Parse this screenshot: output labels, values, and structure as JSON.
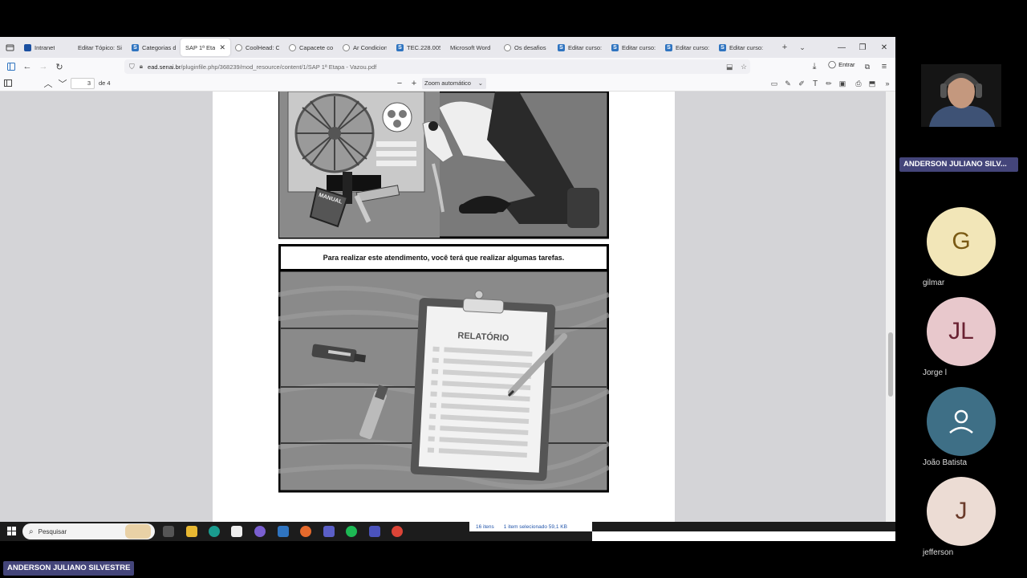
{
  "tabs": [
    {
      "label": "Intranet",
      "icon": "intranet-icon"
    },
    {
      "label": "Editar Tópico: Sit",
      "icon": "none"
    },
    {
      "label": "Categorias d",
      "icon": "senai-s-icon"
    },
    {
      "label": "SAP 1ª Eta",
      "icon": "none",
      "active": true
    },
    {
      "label": "CoolHead: Ca",
      "icon": "globe-icon"
    },
    {
      "label": "Capacete co",
      "icon": "globe-icon"
    },
    {
      "label": "Ar Condicion",
      "icon": "globe-icon"
    },
    {
      "label": "TEC.228.005",
      "icon": "senai-s-icon"
    },
    {
      "label": "Microsoft Word",
      "icon": "none"
    },
    {
      "label": "Os desafios d",
      "icon": "globe-icon"
    },
    {
      "label": "Editar curso: I",
      "icon": "senai-s-icon"
    },
    {
      "label": "Editar curso: I",
      "icon": "senai-s-icon"
    },
    {
      "label": "Editar curso: C",
      "icon": "senai-s-icon"
    },
    {
      "label": "Editar curso: I",
      "icon": "senai-s-icon"
    }
  ],
  "url": {
    "domain": "ead.senai.br",
    "path": "/pluginfile.php/368239/mod_resource/content/1/SAP 1ª Etapa - Vazou.pdf"
  },
  "nav": {
    "entrar": "Entrar"
  },
  "pdf": {
    "page_number": "3",
    "page_total": "de 4",
    "zoom": "Zoom automático",
    "caption": "Para realizar este atendimento, você terá que realizar algumas tarefas.",
    "manual_label": "MANUAL",
    "report_title": "RELATÓRIO"
  },
  "taskbar": {
    "search_placeholder": "Pesquisar",
    "status_items": "16 itens",
    "status_selected": "1 item selecionado  59,1 KB"
  },
  "meeting": {
    "presenter_badge": "ANDERSON JULIANO SILV...",
    "bottom_badge": "ANDERSON JULIANO SILVESTRE",
    "participants": [
      {
        "initials": "G",
        "name": "gilmar",
        "bg": "#f2e6b8",
        "fg": "#7a5a14"
      },
      {
        "initials": "JL",
        "name": "Jorge l",
        "bg": "#e8c8cc",
        "fg": "#6a2232"
      },
      {
        "initials": "",
        "name": "João Batista",
        "bg": "#3e6f86",
        "fg": "#ffffff"
      },
      {
        "initials": "J",
        "name": "jefferson",
        "bg": "#ecdcd4",
        "fg": "#6a3a2a"
      }
    ]
  }
}
